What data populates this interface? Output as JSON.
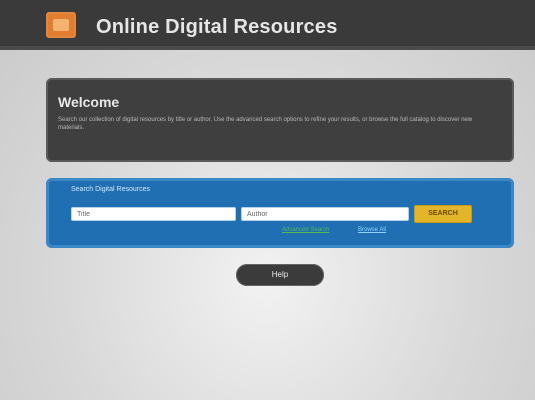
{
  "header": {
    "title": "Online Digital Resources",
    "logo_icon": "book-icon"
  },
  "welcome": {
    "title": "Welcome",
    "text": "Search our collection of digital resources by title or author. Use the advanced search options to refine your results, or browse the full catalog to discover new materials."
  },
  "search": {
    "label": "Search Digital Resources",
    "title_value": "Title",
    "author_value": "Author",
    "button_label": "SEARCH",
    "link_advanced": "Advanced Search",
    "link_browse": "Browse All"
  },
  "actions": {
    "pill_label": "Help"
  },
  "colors": {
    "header_bg": "#3a3a3a",
    "logo": "#e07d2f",
    "welcome_bg": "#3f3f3f",
    "search_bg": "#1f6fb2",
    "button": "#e2b52a",
    "link": "#56b94f"
  }
}
